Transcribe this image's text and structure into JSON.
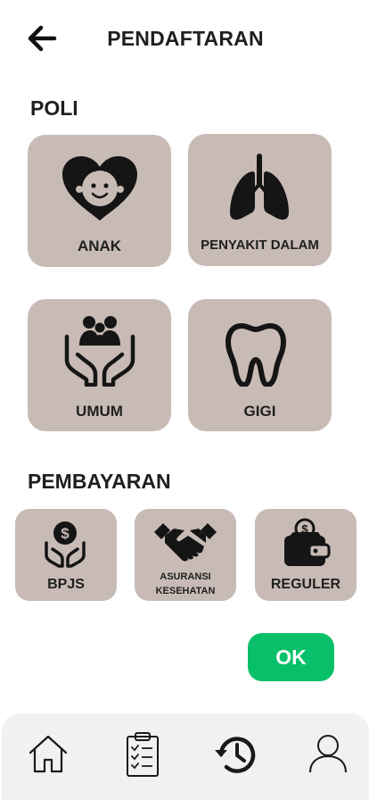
{
  "header": {
    "title": "PENDAFTARAN",
    "back_icon": "arrow-left-icon"
  },
  "poli": {
    "title": "POLI",
    "items": [
      {
        "label": "ANAK",
        "icon": "child-heart-icon"
      },
      {
        "label": "PENYAKIT DALAM",
        "icon": "lungs-icon"
      },
      {
        "label": "UMUM",
        "icon": "family-hands-icon"
      },
      {
        "label": "GIGI",
        "icon": "tooth-icon"
      }
    ]
  },
  "pembayaran": {
    "title": "PEMBAYARAN",
    "items": [
      {
        "label": "BPJS",
        "icon": "money-hands-icon"
      },
      {
        "label_line1": "ASURANSI",
        "label_line2": "KESEHATAN",
        "icon": "handshake-icon"
      },
      {
        "label": "REGULER",
        "icon": "wallet-icon"
      }
    ]
  },
  "actions": {
    "ok_label": "OK",
    "ok_color": "#08c069"
  },
  "colors": {
    "card": "#c8bbb6",
    "nav_bg": "#f2f1f1"
  },
  "bottom_nav": [
    {
      "icon": "home-icon"
    },
    {
      "icon": "clipboard-checklist-icon"
    },
    {
      "icon": "history-icon"
    },
    {
      "icon": "user-icon"
    }
  ]
}
